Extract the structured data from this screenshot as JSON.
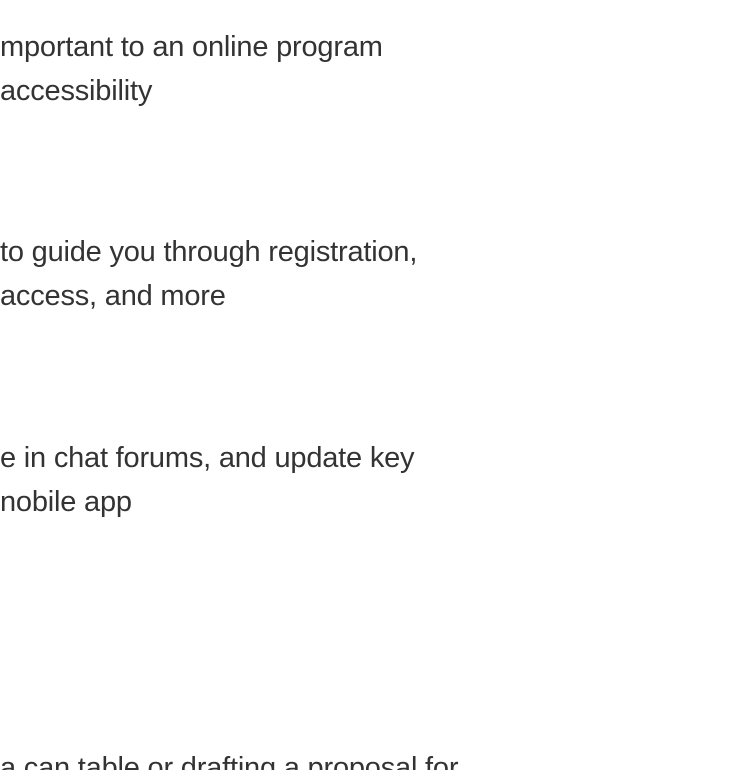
{
  "paragraphs": [
    {
      "lines": [
        "mportant to an online program",
        "accessibility"
      ]
    },
    {
      "lines": [
        " to guide you through registration,",
        " access, and more"
      ]
    },
    {
      "lines": [
        "e in chat forums, and update key",
        "nobile app"
      ]
    },
    {
      "lines": [
        " a can table or drafting a proposal for"
      ]
    }
  ],
  "colors": {
    "text": "#333333",
    "background": "#ffffff"
  }
}
